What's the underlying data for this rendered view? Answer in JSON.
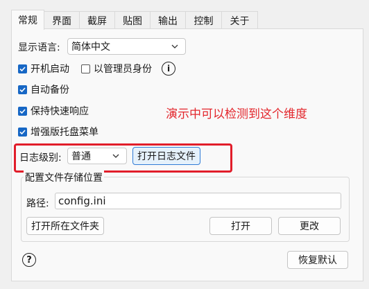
{
  "tabs": [
    {
      "label": "常规",
      "active": true
    },
    {
      "label": "界面",
      "active": false
    },
    {
      "label": "截屏",
      "active": false
    },
    {
      "label": "贴图",
      "active": false
    },
    {
      "label": "输出",
      "active": false
    },
    {
      "label": "控制",
      "active": false
    },
    {
      "label": "关于",
      "active": false
    }
  ],
  "language": {
    "label": "显示语言:",
    "value": "简体中文"
  },
  "options": [
    {
      "label": "开机启动",
      "checked": true
    },
    {
      "label": "以管理员身份",
      "checked": false
    },
    {
      "label": "自动备份",
      "checked": true
    },
    {
      "label": "保持快速响应",
      "checked": true
    },
    {
      "label": "增强版托盘菜单",
      "checked": true
    }
  ],
  "info_icon": "info-circle-icon",
  "annotation": {
    "text": "演示中可以检测到这个维度",
    "color": "#e3262c"
  },
  "log": {
    "label": "日志级别:",
    "value": "普通",
    "open_button": "打开日志文件"
  },
  "config_storage": {
    "title": "配置文件存储位置",
    "path_label": "路径:",
    "path_value": "config.ini",
    "open_folder_button": "打开所在文件夹",
    "open_button": "打开",
    "change_button": "更改"
  },
  "footer": {
    "help_icon": "help-circle-icon",
    "restore_button": "恢复默认"
  },
  "colors": {
    "accent": "#1767c5",
    "annotation_red": "#e11d2a",
    "focus_border": "#2f7bd6"
  }
}
